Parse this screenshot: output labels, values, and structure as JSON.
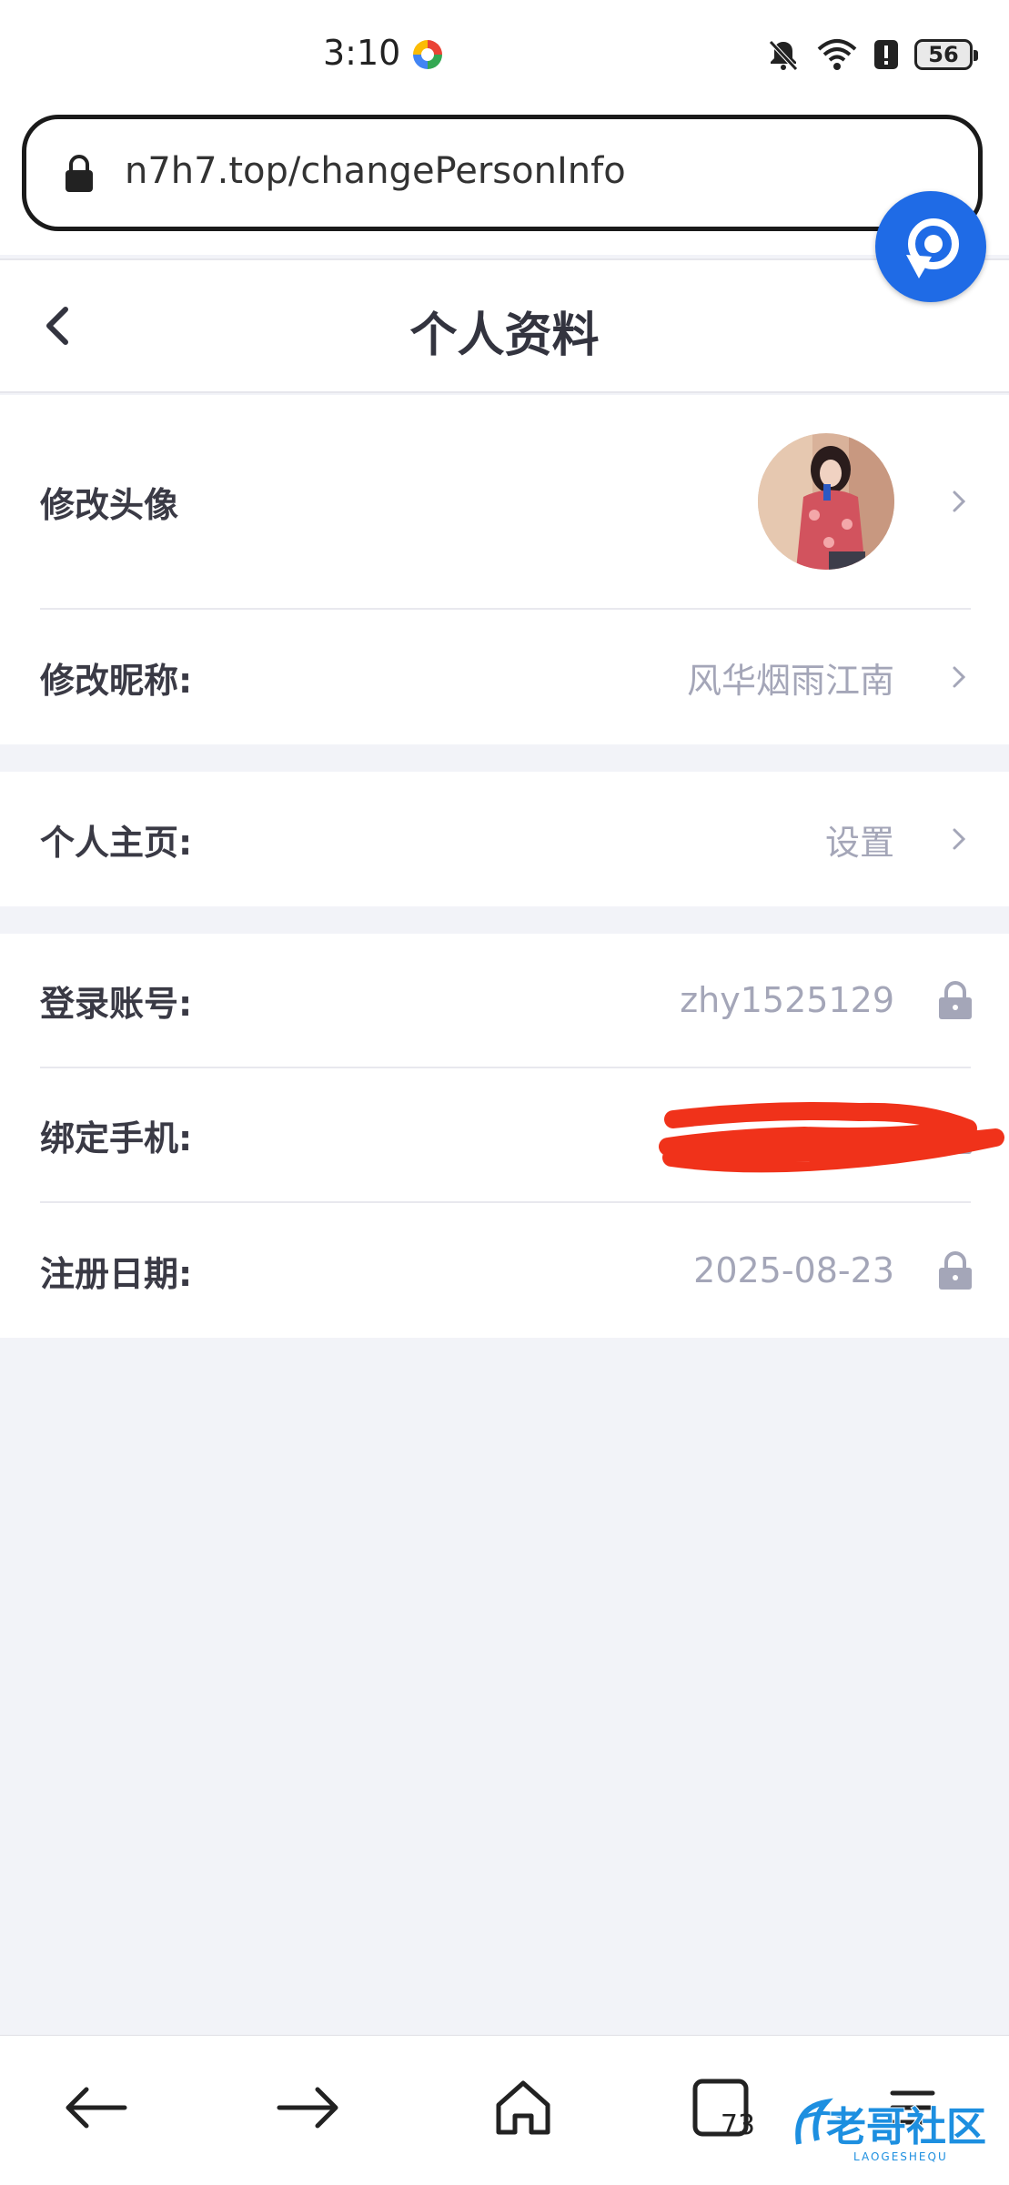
{
  "status_bar": {
    "time": "3:10",
    "battery": "56",
    "icons": [
      "app-indicator-icon",
      "mute-bell-icon",
      "wifi-icon",
      "alert-icon",
      "battery-icon"
    ]
  },
  "browser": {
    "url": "n7h7.top/changePersonInfo",
    "floating_button_icon": "refresh-icon",
    "accent_color": "#1f6be6"
  },
  "header": {
    "title": "个人资料",
    "back_icon": "chevron-left-icon"
  },
  "profile": {
    "avatar": {
      "label": "修改头像"
    },
    "nickname": {
      "label": "修改昵称:",
      "value": "风华烟雨江南"
    },
    "homepage": {
      "label": "个人主页:",
      "value": "设置"
    },
    "account": {
      "label": "登录账号:",
      "value": "zhy1525129"
    },
    "phone": {
      "label": "绑定手机:",
      "value": ""
    },
    "register_date": {
      "label": "注册日期:",
      "value": "2025-08-23"
    }
  },
  "bottom_nav": {
    "items": [
      "back-arrow-icon",
      "forward-arrow-icon",
      "home-icon",
      "tabs-icon",
      "menu-icon"
    ],
    "tab_count": "73"
  },
  "watermark": {
    "text": "老哥社区",
    "subtext": "LAOGESHEQU"
  },
  "colors": {
    "background": "#f2f3f8",
    "value_text": "#a4a6b8",
    "redaction": "#f0321a"
  }
}
